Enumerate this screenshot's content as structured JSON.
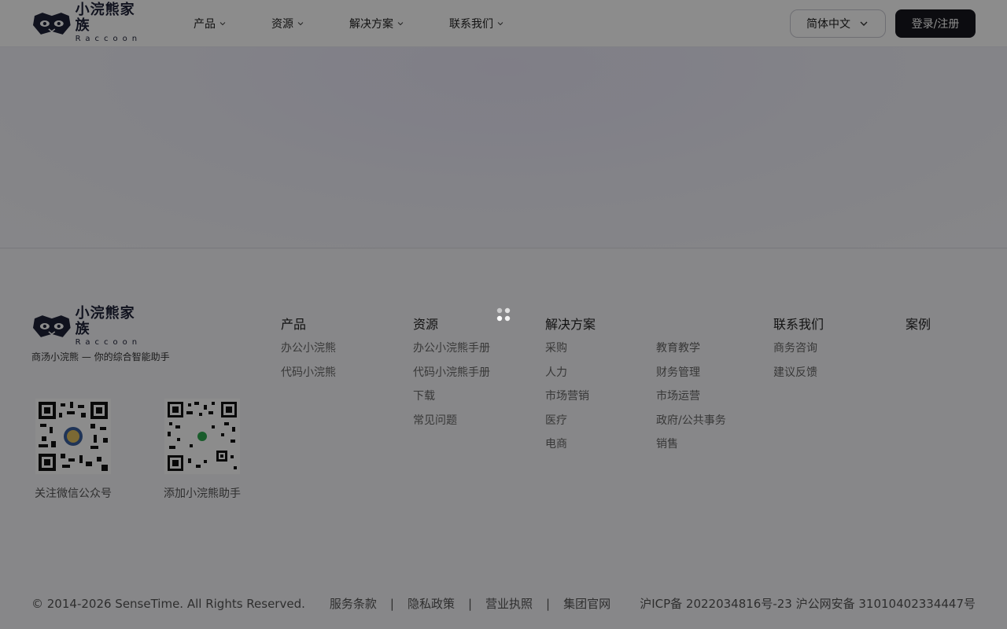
{
  "brand": {
    "name_cn": "小浣熊家族",
    "name_en": "Raccoon"
  },
  "header": {
    "nav": [
      {
        "label": "产品"
      },
      {
        "label": "资源"
      },
      {
        "label": "解决方案"
      },
      {
        "label": "联系我们"
      }
    ],
    "language": "简体中文",
    "login_label": "登录/注册"
  },
  "footer": {
    "slogan": "商汤小浣熊 — 你的综合智能助手",
    "qr_codes": [
      {
        "caption": "关注微信公众号"
      },
      {
        "caption": "添加小浣熊助手"
      }
    ],
    "columns": [
      {
        "title": "产品",
        "links": [
          "办公小浣熊",
          "代码小浣熊"
        ]
      },
      {
        "title": "资源",
        "links": [
          "办公小浣熊手册",
          "代码小浣熊手册",
          "下载",
          "常见问题"
        ]
      },
      {
        "title": "解决方案",
        "links": [
          "采购",
          "人力",
          "市场营销",
          "医疗",
          "电商"
        ]
      },
      {
        "title": "",
        "links": [
          "教育教学",
          "财务管理",
          "市场运营",
          "政府/公共事务",
          "销售"
        ]
      },
      {
        "title": "联系我们",
        "links": [
          "商务咨询",
          "建议反馈"
        ]
      },
      {
        "title": "案例",
        "links": []
      }
    ],
    "copyright": "© 2014-2026 SenseTime. All Rights Reserved.",
    "bottom_links": [
      "服务条款",
      "隐私政策",
      "营业执照",
      "集团官网"
    ],
    "icp": "沪ICP备 2022034816号-23 沪公网安备 31010402334447号"
  },
  "colors": {
    "brand_dark": "#1e2238",
    "login_bg": "#16161e",
    "overlay": "rgba(0,0,0,0.45)"
  }
}
